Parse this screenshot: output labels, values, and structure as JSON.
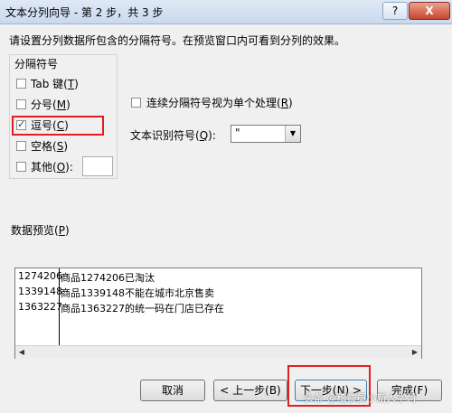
{
  "window": {
    "title": "文本分列向导 - 第 2 步，共 3 步",
    "help": "?",
    "close": "X"
  },
  "instruction": "请设置分列数据所包含的分隔符号。在预览窗口内可看到分列的效果。",
  "delimiters": {
    "legend": "分隔符号",
    "tab": {
      "label": "Tab 键",
      "key": "T",
      "checked": false
    },
    "semicolon": {
      "label": "分号",
      "key": "M",
      "checked": false
    },
    "comma": {
      "label": "逗号",
      "key": "C",
      "checked": true
    },
    "space": {
      "label": "空格",
      "key": "S",
      "checked": false
    },
    "other": {
      "label": "其他",
      "key": "O",
      "checked": false,
      "value": ""
    }
  },
  "consecutive": {
    "label": "连续分隔符号视为单个处理",
    "key": "R",
    "checked": false
  },
  "text_qualifier": {
    "label": "文本识别符号",
    "key": "Q",
    "value": "\""
  },
  "preview": {
    "label": "数据预览",
    "key": "P",
    "rows": [
      [
        "1274206",
        "商品1274206已淘汰"
      ],
      [
        "1339148",
        "商品1339148不能在城市北京售卖"
      ],
      [
        "1363227",
        "商品1363227的统一码在门店已存在"
      ]
    ]
  },
  "buttons": {
    "cancel": "取消",
    "back": "< 上一步(B)",
    "next": "下一步(N) >",
    "finish": "完成(F)"
  },
  "watermark": "头条 @稽察员小新人学习"
}
